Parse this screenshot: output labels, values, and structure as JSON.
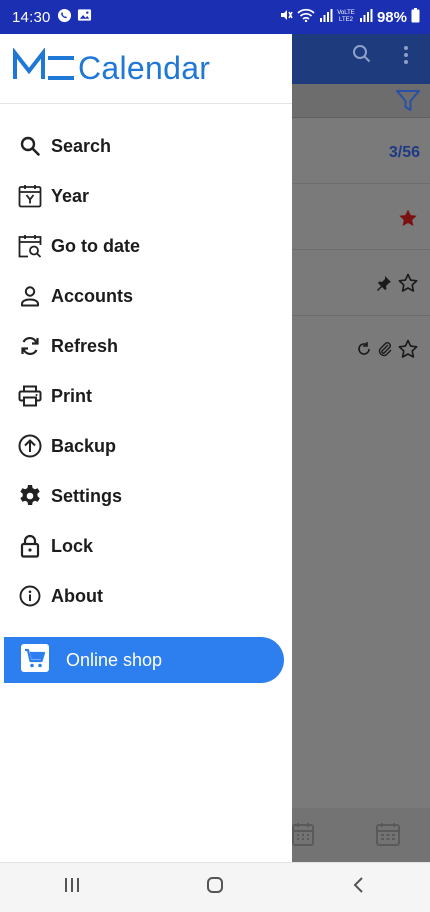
{
  "status_bar": {
    "time": "14:30",
    "battery": "98%",
    "icons": [
      "whatsapp-icon",
      "gallery-icon",
      "mute-icon",
      "wifi-icon",
      "signal-icon",
      "volte-icon",
      "battery-icon"
    ]
  },
  "app": {
    "counter": "3/56",
    "colors": {
      "header": "#1d3b7d",
      "accent": "#1f78d6",
      "shop": "#2d7ff0"
    }
  },
  "drawer": {
    "logo_text": "Calendar",
    "menu": [
      {
        "label": "Search",
        "icon": "search-icon"
      },
      {
        "label": "Year",
        "icon": "year-calendar-icon"
      },
      {
        "label": "Go to date",
        "icon": "calendar-search-icon"
      },
      {
        "label": "Accounts",
        "icon": "person-icon"
      },
      {
        "label": "Refresh",
        "icon": "refresh-icon"
      },
      {
        "label": "Print",
        "icon": "printer-icon"
      },
      {
        "label": "Backup",
        "icon": "upload-icon"
      },
      {
        "label": "Settings",
        "icon": "gear-icon"
      },
      {
        "label": "Lock",
        "icon": "lock-icon"
      },
      {
        "label": "About",
        "icon": "info-icon"
      }
    ],
    "shop": {
      "label": "Online shop",
      "icon": "cart-icon"
    }
  },
  "nav_bar": {
    "buttons": [
      "recent-apps-icon",
      "home-icon",
      "back-icon"
    ]
  }
}
